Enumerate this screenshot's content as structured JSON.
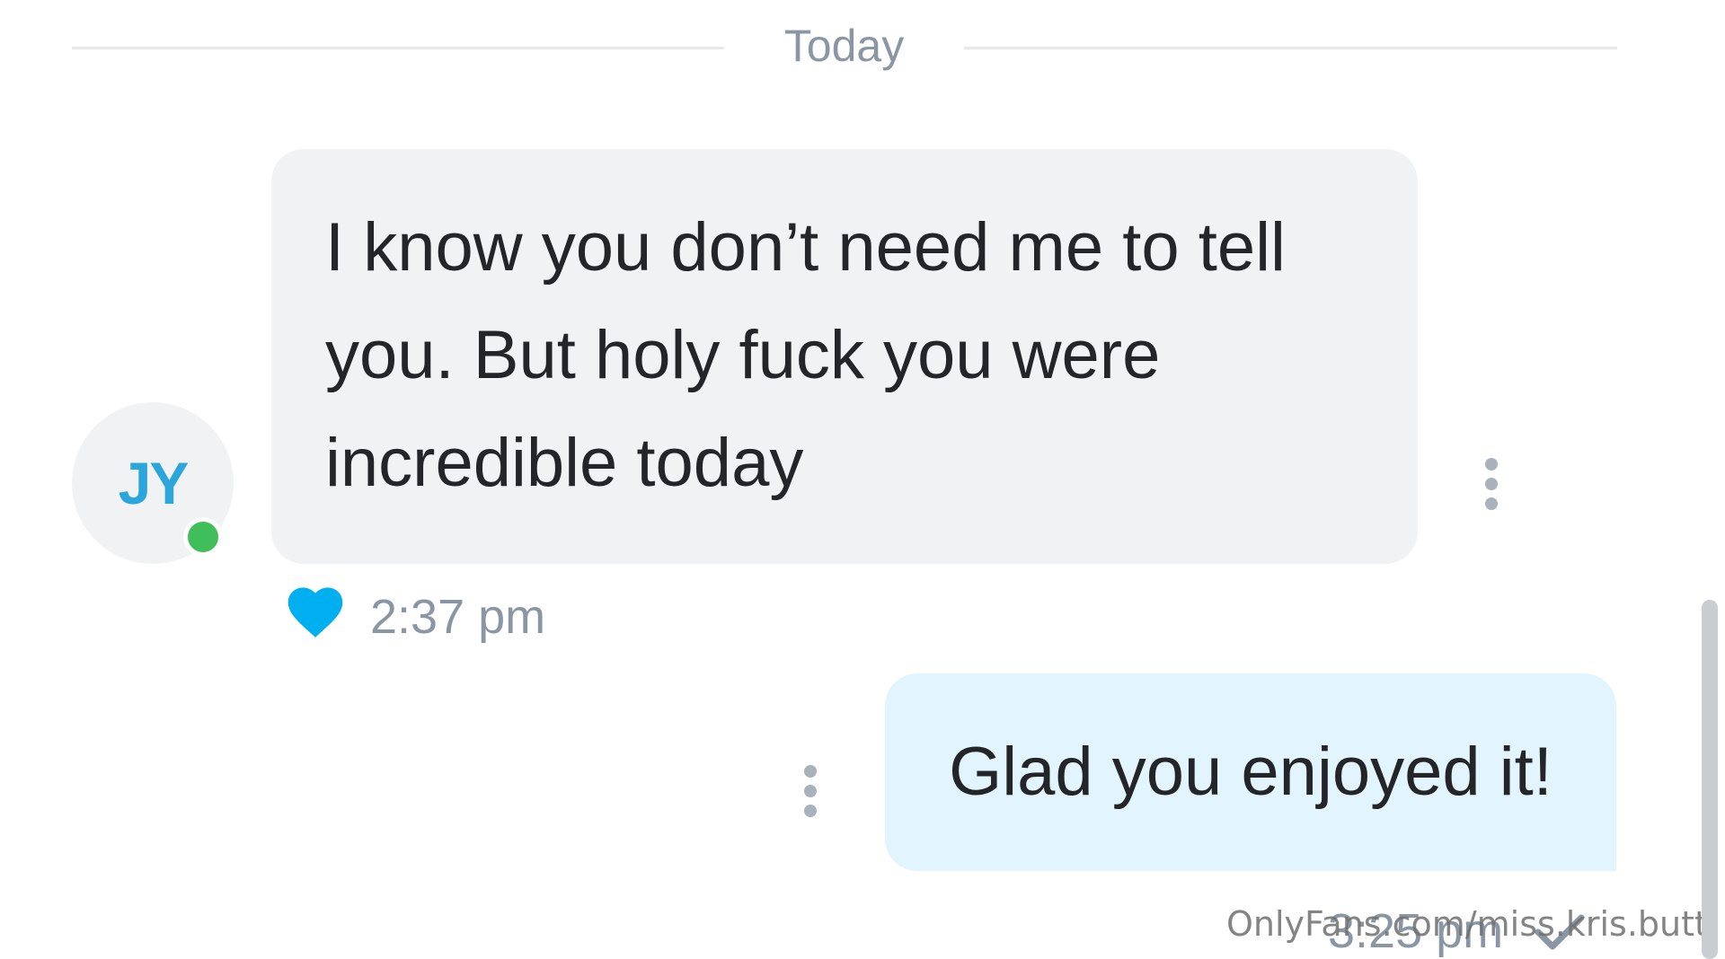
{
  "chat": {
    "date_divider": "Today",
    "messages": [
      {
        "direction": "received",
        "avatar_initials": "JY",
        "online": true,
        "text": "I know you don’t need me to tell you. But holy fuck you were incredible today",
        "time": "2:37 pm",
        "liked": true
      },
      {
        "direction": "sent",
        "text": "Glad you enjoyed it!",
        "time": "3:25 pm",
        "status": "sent"
      }
    ]
  },
  "watermark": "OnlyFans.com/miss.kris.butt",
  "colors": {
    "accent": "#00aff0",
    "received_bubble": "#f1f2f4",
    "sent_bubble": "#e2f5fe",
    "online": "#3fbe5a",
    "muted_text": "#8a96a3"
  },
  "icons": {
    "like": "heart-icon",
    "status": "check-icon",
    "menu": "more-vertical-icon"
  }
}
